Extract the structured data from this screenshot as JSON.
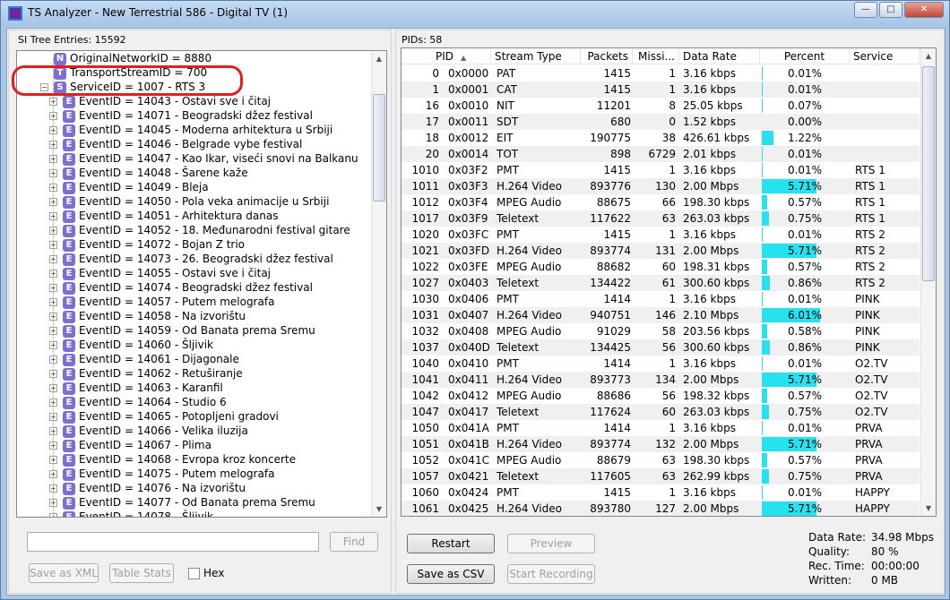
{
  "window": {
    "title": "TS Analyzer - New Terrestrial 586 - Digital TV (1)",
    "minimize": "—",
    "maximize": "□",
    "close": "✕"
  },
  "left_panel": {
    "label": "SI Tree Entries: 15592",
    "tree": [
      {
        "icon": "N",
        "label": "OriginalNetworkID = 8880",
        "level": 0,
        "expander": ""
      },
      {
        "icon": "T",
        "label": "TransportStreamID = 700",
        "level": 0,
        "expander": ""
      },
      {
        "icon": "S",
        "label": "ServiceID = 1007 - RTS 3",
        "level": 0,
        "expander": "−"
      },
      {
        "icon": "E",
        "label": "EventID = 14043 - Ostavi sve i čitaj",
        "level": 1,
        "expander": "+"
      },
      {
        "icon": "E",
        "label": "EventID = 14071 - Beogradski džez festival",
        "level": 1,
        "expander": "+"
      },
      {
        "icon": "E",
        "label": "EventID = 14045 - Moderna arhitektura u Srbiji",
        "level": 1,
        "expander": "+"
      },
      {
        "icon": "E",
        "label": "EventID = 14046 - Belgrade vybe festival",
        "level": 1,
        "expander": "+"
      },
      {
        "icon": "E",
        "label": "EventID = 14047 - Kao Ikar, viseći snovi na Balkanu",
        "level": 1,
        "expander": "+"
      },
      {
        "icon": "E",
        "label": "EventID = 14048 - Šarene kaže",
        "level": 1,
        "expander": "+"
      },
      {
        "icon": "E",
        "label": "EventID = 14049 - Bleja",
        "level": 1,
        "expander": "+"
      },
      {
        "icon": "E",
        "label": "EventID = 14050 - Pola veka animacije u Srbiji",
        "level": 1,
        "expander": "+"
      },
      {
        "icon": "E",
        "label": "EventID = 14051 - Arhitektura danas",
        "level": 1,
        "expander": "+"
      },
      {
        "icon": "E",
        "label": "EventID = 14052 - 18. Međunarodni festival gitare",
        "level": 1,
        "expander": "+"
      },
      {
        "icon": "E",
        "label": "EventID = 14072 - Bojan Z trio",
        "level": 1,
        "expander": "+"
      },
      {
        "icon": "E",
        "label": "EventID = 14073 - 26. Beogradski džez festival",
        "level": 1,
        "expander": "+"
      },
      {
        "icon": "E",
        "label": "EventID = 14055 - Ostavi sve i čitaj",
        "level": 1,
        "expander": "+"
      },
      {
        "icon": "E",
        "label": "EventID = 14074 - Beogradski džez festival",
        "level": 1,
        "expander": "+"
      },
      {
        "icon": "E",
        "label": "EventID = 14057 - Putem melografa",
        "level": 1,
        "expander": "+"
      },
      {
        "icon": "E",
        "label": "EventID = 14058 - Na izvorištu",
        "level": 1,
        "expander": "+"
      },
      {
        "icon": "E",
        "label": "EventID = 14059 - Od Banata prema Sremu",
        "level": 1,
        "expander": "+"
      },
      {
        "icon": "E",
        "label": "EventID = 14060 - Šljivik",
        "level": 1,
        "expander": "+"
      },
      {
        "icon": "E",
        "label": "EventID = 14061 - Dijagonale",
        "level": 1,
        "expander": "+"
      },
      {
        "icon": "E",
        "label": "EventID = 14062 - Retuširanje",
        "level": 1,
        "expander": "+"
      },
      {
        "icon": "E",
        "label": "EventID = 14063 - Karanfil",
        "level": 1,
        "expander": "+"
      },
      {
        "icon": "E",
        "label": "EventID = 14064 - Studio 6",
        "level": 1,
        "expander": "+"
      },
      {
        "icon": "E",
        "label": "EventID = 14065 - Potopljeni gradovi",
        "level": 1,
        "expander": "+"
      },
      {
        "icon": "E",
        "label": "EventID = 14066 - Velika iluzija",
        "level": 1,
        "expander": "+"
      },
      {
        "icon": "E",
        "label": "EventID = 14067 - Plima",
        "level": 1,
        "expander": "+"
      },
      {
        "icon": "E",
        "label": "EventID = 14068 - Evropa kroz koncerte",
        "level": 1,
        "expander": "+"
      },
      {
        "icon": "E",
        "label": "EventID = 14075 - Putem melografa",
        "level": 1,
        "expander": "+"
      },
      {
        "icon": "E",
        "label": "EventID = 14076 - Na izvorištu",
        "level": 1,
        "expander": "+"
      },
      {
        "icon": "E",
        "label": "EventID = 14077 - Od Banata prema Sremu",
        "level": 1,
        "expander": "+"
      },
      {
        "icon": "E",
        "label": "EventID = 14078 - Šljivik",
        "level": 1,
        "expander": "+"
      }
    ],
    "search": {
      "value": "",
      "find_label": "Find"
    },
    "save_xml_label": "Save as XML",
    "table_stats_label": "Table Stats",
    "hex_label": "Hex"
  },
  "right_panel": {
    "label": "PIDs: 58",
    "columns": [
      "PID",
      "Stream Type",
      "Packets",
      "Missi...",
      "Data Rate",
      "Percent",
      "Service"
    ],
    "sort_indicator": "▲",
    "rows": [
      {
        "pid": "0",
        "hex": "0x0000",
        "type": "PAT",
        "packets": "1415",
        "missing": "1",
        "rate": "3.16 kbps",
        "percent": "0.01%",
        "pct": 0.01,
        "service": ""
      },
      {
        "pid": "1",
        "hex": "0x0001",
        "type": "CAT",
        "packets": "1415",
        "missing": "1",
        "rate": "3.16 kbps",
        "percent": "0.01%",
        "pct": 0.01,
        "service": ""
      },
      {
        "pid": "16",
        "hex": "0x0010",
        "type": "NIT",
        "packets": "11201",
        "missing": "8",
        "rate": "25.05 kbps",
        "percent": "0.07%",
        "pct": 0.07,
        "service": ""
      },
      {
        "pid": "17",
        "hex": "0x0011",
        "type": "SDT",
        "packets": "680",
        "missing": "0",
        "rate": "1.52 kbps",
        "percent": "0.00%",
        "pct": 0.0,
        "service": ""
      },
      {
        "pid": "18",
        "hex": "0x0012",
        "type": "EIT",
        "packets": "190775",
        "missing": "38",
        "rate": "426.61 kbps",
        "percent": "1.22%",
        "pct": 1.22,
        "service": ""
      },
      {
        "pid": "20",
        "hex": "0x0014",
        "type": "TOT",
        "packets": "898",
        "missing": "6729",
        "rate": "2.01 kbps",
        "percent": "0.01%",
        "pct": 0.01,
        "service": ""
      },
      {
        "pid": "1010",
        "hex": "0x03F2",
        "type": "PMT",
        "packets": "1415",
        "missing": "1",
        "rate": "3.16 kbps",
        "percent": "0.01%",
        "pct": 0.01,
        "service": "RTS 1"
      },
      {
        "pid": "1011",
        "hex": "0x03F3",
        "type": "H.264 Video",
        "packets": "893776",
        "missing": "130",
        "rate": "2.00 Mbps",
        "percent": "5.71%",
        "pct": 5.71,
        "service": "RTS 1"
      },
      {
        "pid": "1012",
        "hex": "0x03F4",
        "type": "MPEG Audio",
        "packets": "88675",
        "missing": "66",
        "rate": "198.30 kbps",
        "percent": "0.57%",
        "pct": 0.57,
        "service": "RTS 1"
      },
      {
        "pid": "1017",
        "hex": "0x03F9",
        "type": "Teletext",
        "packets": "117622",
        "missing": "63",
        "rate": "263.03 kbps",
        "percent": "0.75%",
        "pct": 0.75,
        "service": "RTS 1"
      },
      {
        "pid": "1020",
        "hex": "0x03FC",
        "type": "PMT",
        "packets": "1415",
        "missing": "1",
        "rate": "3.16 kbps",
        "percent": "0.01%",
        "pct": 0.01,
        "service": "RTS 2"
      },
      {
        "pid": "1021",
        "hex": "0x03FD",
        "type": "H.264 Video",
        "packets": "893774",
        "missing": "131",
        "rate": "2.00 Mbps",
        "percent": "5.71%",
        "pct": 5.71,
        "service": "RTS 2"
      },
      {
        "pid": "1022",
        "hex": "0x03FE",
        "type": "MPEG Audio",
        "packets": "88682",
        "missing": "60",
        "rate": "198.31 kbps",
        "percent": "0.57%",
        "pct": 0.57,
        "service": "RTS 2"
      },
      {
        "pid": "1027",
        "hex": "0x0403",
        "type": "Teletext",
        "packets": "134422",
        "missing": "61",
        "rate": "300.60 kbps",
        "percent": "0.86%",
        "pct": 0.86,
        "service": "RTS 2"
      },
      {
        "pid": "1030",
        "hex": "0x0406",
        "type": "PMT",
        "packets": "1414",
        "missing": "1",
        "rate": "3.16 kbps",
        "percent": "0.01%",
        "pct": 0.01,
        "service": "PINK"
      },
      {
        "pid": "1031",
        "hex": "0x0407",
        "type": "H.264 Video",
        "packets": "940751",
        "missing": "146",
        "rate": "2.10 Mbps",
        "percent": "6.01%",
        "pct": 6.01,
        "service": "PINK"
      },
      {
        "pid": "1032",
        "hex": "0x0408",
        "type": "MPEG Audio",
        "packets": "91029",
        "missing": "58",
        "rate": "203.56 kbps",
        "percent": "0.58%",
        "pct": 0.58,
        "service": "PINK"
      },
      {
        "pid": "1037",
        "hex": "0x040D",
        "type": "Teletext",
        "packets": "134425",
        "missing": "56",
        "rate": "300.60 kbps",
        "percent": "0.86%",
        "pct": 0.86,
        "service": "PINK"
      },
      {
        "pid": "1040",
        "hex": "0x0410",
        "type": "PMT",
        "packets": "1414",
        "missing": "1",
        "rate": "3.16 kbps",
        "percent": "0.01%",
        "pct": 0.01,
        "service": "O2.TV"
      },
      {
        "pid": "1041",
        "hex": "0x0411",
        "type": "H.264 Video",
        "packets": "893773",
        "missing": "134",
        "rate": "2.00 Mbps",
        "percent": "5.71%",
        "pct": 5.71,
        "service": "O2.TV"
      },
      {
        "pid": "1042",
        "hex": "0x0412",
        "type": "MPEG Audio",
        "packets": "88686",
        "missing": "56",
        "rate": "198.32 kbps",
        "percent": "0.57%",
        "pct": 0.57,
        "service": "O2.TV"
      },
      {
        "pid": "1047",
        "hex": "0x0417",
        "type": "Teletext",
        "packets": "117624",
        "missing": "60",
        "rate": "263.03 kbps",
        "percent": "0.75%",
        "pct": 0.75,
        "service": "O2.TV"
      },
      {
        "pid": "1050",
        "hex": "0x041A",
        "type": "PMT",
        "packets": "1414",
        "missing": "1",
        "rate": "3.16 kbps",
        "percent": "0.01%",
        "pct": 0.01,
        "service": "PRVA"
      },
      {
        "pid": "1051",
        "hex": "0x041B",
        "type": "H.264 Video",
        "packets": "893774",
        "missing": "132",
        "rate": "2.00 Mbps",
        "percent": "5.71%",
        "pct": 5.71,
        "service": "PRVA"
      },
      {
        "pid": "1052",
        "hex": "0x041C",
        "type": "MPEG Audio",
        "packets": "88679",
        "missing": "63",
        "rate": "198.30 kbps",
        "percent": "0.57%",
        "pct": 0.57,
        "service": "PRVA"
      },
      {
        "pid": "1057",
        "hex": "0x0421",
        "type": "Teletext",
        "packets": "117605",
        "missing": "63",
        "rate": "262.99 kbps",
        "percent": "0.75%",
        "pct": 0.75,
        "service": "PRVA"
      },
      {
        "pid": "1060",
        "hex": "0x0424",
        "type": "PMT",
        "packets": "1415",
        "missing": "1",
        "rate": "3.16 kbps",
        "percent": "0.01%",
        "pct": 0.01,
        "service": "HAPPY"
      },
      {
        "pid": "1061",
        "hex": "0x0425",
        "type": "H.264 Video",
        "packets": "893780",
        "missing": "127",
        "rate": "2.00 Mbps",
        "percent": "5.71%",
        "pct": 5.71,
        "service": "HAPPY"
      }
    ],
    "restart_label": "Restart",
    "preview_label": "Preview",
    "save_csv_label": "Save as CSV",
    "start_recording_label": "Start Recording",
    "stats": {
      "data_rate_label": "Data Rate:",
      "data_rate": "34.98 Mbps",
      "quality_label": "Quality:",
      "quality": "80 %",
      "rec_time_label": "Rec. Time:",
      "rec_time": "00:00:00",
      "written_label": "Written:",
      "written": "0 MB"
    }
  },
  "colors": {
    "percent_bar": "#26e2ef",
    "highlight": "#e0201a",
    "tree_icon": "#7d6fd0"
  }
}
